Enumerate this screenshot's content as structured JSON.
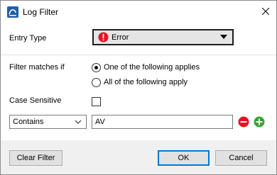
{
  "window": {
    "title": "Log Filter",
    "icon": "log-filter-app-icon",
    "close_icon": "close-icon"
  },
  "entry_type": {
    "label": "Entry Type",
    "value": "Error",
    "value_icon": "error-icon",
    "value_icon_color": "#e81123",
    "selected_color": "#e5e5e5"
  },
  "filter_matches": {
    "label": "Filter matches if",
    "options": [
      {
        "label": "One of the following applies",
        "selected": true
      },
      {
        "label": "All of the following apply",
        "selected": false
      }
    ]
  },
  "case_sensitive": {
    "label": "Case Sensitive",
    "checked": false
  },
  "condition": {
    "operator": "Contains",
    "value": "AV",
    "remove_icon": "minus-circle-icon",
    "remove_color": "#e81123",
    "add_icon": "plus-circle-icon",
    "add_color": "#3aa335"
  },
  "buttons": {
    "clear_filter": "Clear Filter",
    "ok": "OK",
    "cancel": "Cancel"
  },
  "colors": {
    "accent": "#0078d7",
    "app_icon": "#1f5fa9"
  }
}
